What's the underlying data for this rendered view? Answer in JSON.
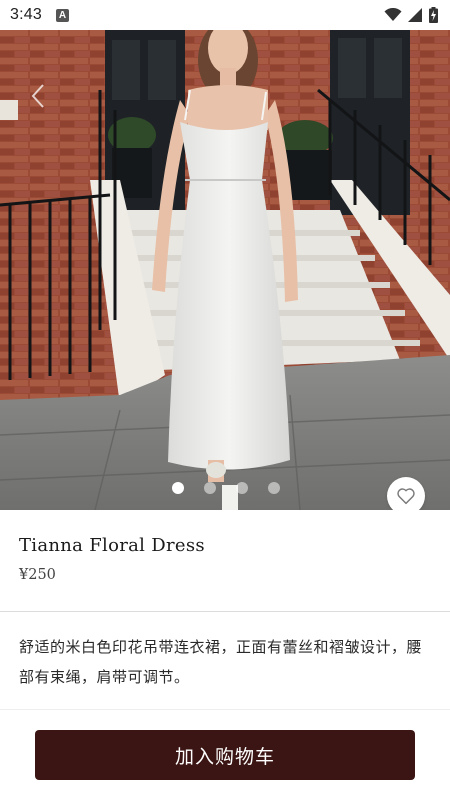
{
  "status_bar": {
    "time": "3:43",
    "notification_badge": "A",
    "icons": [
      "wifi-icon",
      "signal-icon",
      "battery-charging-icon"
    ]
  },
  "gallery": {
    "image_count": 4,
    "active_index": 0,
    "back_icon": "chevron-left-icon",
    "favorite_icon": "heart-outline-icon"
  },
  "product": {
    "name": "Tianna Floral Dress",
    "price": "¥250",
    "description": "舒适的米白色印花吊带连衣裙，正面有蕾丝和褶皱设计，腰部有束绳，肩带可调节。"
  },
  "actions": {
    "add_to_cart": "加入购物车"
  },
  "colors": {
    "button": "#3a1513",
    "background": "#ffffff"
  }
}
